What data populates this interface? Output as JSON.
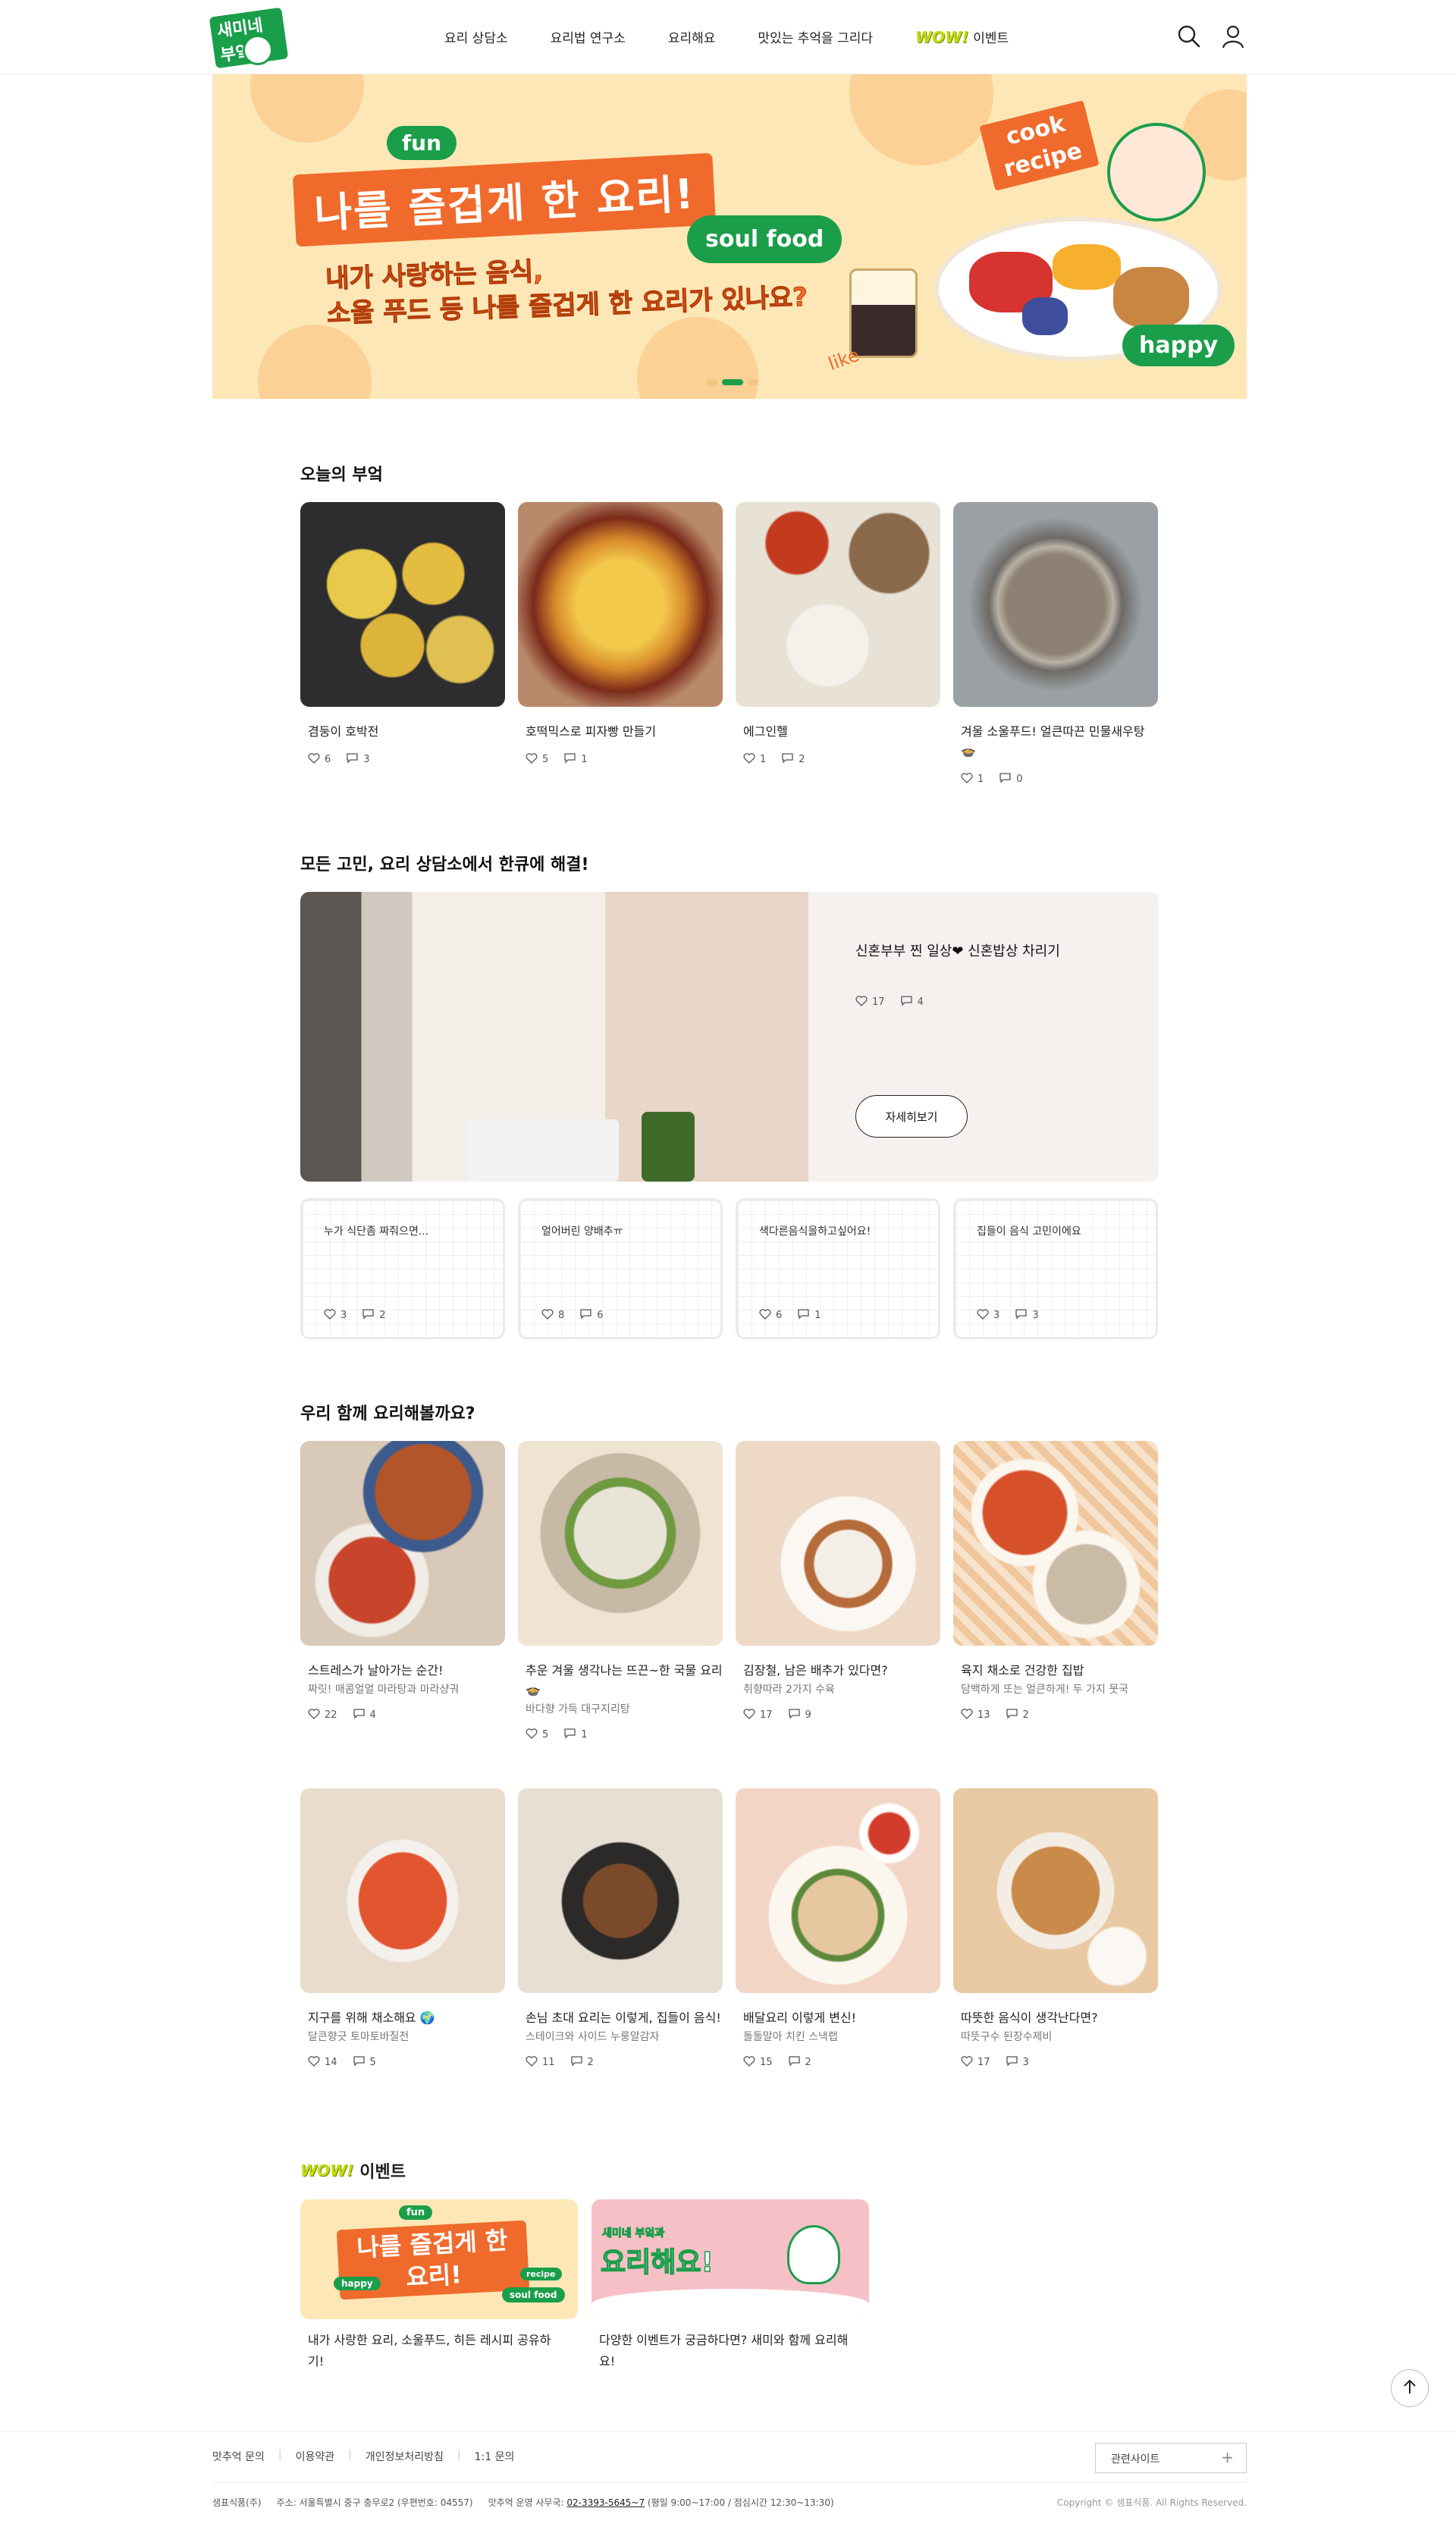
{
  "header": {
    "logo_text": "새미네부엌",
    "nav": [
      "요리 상담소",
      "요리법 연구소",
      "요리해요",
      "맛있는 추억을 그리다"
    ],
    "event_wow": "WOW!",
    "event_label": "이벤트",
    "icons": [
      "search-icon",
      "user-icon"
    ]
  },
  "banner": {
    "tag_fun": "fun",
    "title": "나를 즐겁게 한 요리!",
    "tag_soul": "soul food",
    "subtitle_1": "내가 사랑하는 음식,",
    "subtitle_2": "소울 푸드 등 나를 즐겁게 한 요리가 있나요?",
    "tag_cook": "cook",
    "tag_recipe": "recipe",
    "tag_happy": "happy",
    "tag_like": "like",
    "active_slide": 2,
    "slide_count": 3
  },
  "today": {
    "title": "오늘의 부엌",
    "cards": [
      {
        "title": "겸둥이 호박전",
        "likes": "6",
        "comments": "3"
      },
      {
        "title": "호떡믹스로 피자빵 만들기",
        "likes": "5",
        "comments": "1"
      },
      {
        "title": "에그인헬",
        "likes": "1",
        "comments": "2"
      },
      {
        "title": "겨울 소울푸드! 얼큰따끈 민물새우탕🍲",
        "likes": "1",
        "comments": "0"
      }
    ]
  },
  "consult": {
    "title": "모든 고민, 요리 상담소에서 한큐에 해결!",
    "feature": {
      "title": "신혼부부 찐 일상❤ 신혼밥상 차리기",
      "likes": "17",
      "comments": "4",
      "button": "자세히보기"
    },
    "questions": [
      {
        "text": "누가 식단좀 짜줘으면...",
        "likes": "3",
        "comments": "2"
      },
      {
        "text": "얼어버린 양배추ㅠ",
        "likes": "8",
        "comments": "6"
      },
      {
        "text": "색다른음식을하고싶어요!",
        "likes": "6",
        "comments": "1"
      },
      {
        "text": "집들이 음식 고민이에요",
        "likes": "3",
        "comments": "3"
      }
    ]
  },
  "cook": {
    "title": "우리 함께 요리해볼까요?",
    "cards": [
      {
        "title": "스트레스가 날아가는 순간!",
        "sub": "짜릿! 매콤얼얼 마라탕과 마라샹궈",
        "likes": "22",
        "comments": "4"
      },
      {
        "title": "추운 겨울 생각나는 뜨끈~한 국물 요리🍲",
        "sub": "바다향 가득 대구지리탕",
        "likes": "5",
        "comments": "1"
      },
      {
        "title": "김장철, 남은 배추가 있다면?",
        "sub": "취향따라 2가지 수육",
        "likes": "17",
        "comments": "9"
      },
      {
        "title": "육지 채소로 건강한 집밥",
        "sub": "담백하게 또는 얼큰하게! 두 가지 뭇국",
        "likes": "13",
        "comments": "2"
      },
      {
        "title": "지구를 위해 채소해요 🌍",
        "sub": "달큰향긋 토마토바질전",
        "likes": "14",
        "comments": "5"
      },
      {
        "title": "손님 초대 요리는 이렇게, 집들이 음식!",
        "sub": "스테이크와 사이드 누룽알감자",
        "likes": "11",
        "comments": "2"
      },
      {
        "title": "배달요리 이렇게 변신!",
        "sub": "돌돌말아 치킨 스낵랩",
        "likes": "15",
        "comments": "2"
      },
      {
        "title": "따뜻한 음식이 생각난다면?",
        "sub": "따뜻구수 된장수제비",
        "likes": "17",
        "comments": "3"
      }
    ]
  },
  "events": {
    "wow": "WOW!",
    "title": "이벤트",
    "cards": [
      {
        "desc": "내가 사랑한 요리, 소울푸드, 히든 레시피 공유하기!",
        "thumb_title": "나를 즐겁게 한 요리!",
        "thumb_fun": "fun",
        "thumb_happy": "happy",
        "thumb_recipe": "recipe",
        "thumb_soul": "soul food"
      },
      {
        "desc": "다양한 이벤트가 궁금하다면? 새미와 함께 요리해요!",
        "thumb_small": "새미네 부엌과",
        "thumb_title": "요리해요!"
      }
    ]
  },
  "footer": {
    "links": [
      "맛추억 문의",
      "이용약관",
      "개인정보처리방침",
      "1:1 문의"
    ],
    "related": "관련사이트",
    "company": "샘표식품(주)",
    "address": "주소: 서울특별시 중구 충무로2 (우편번호: 04557)",
    "office": "맛추억 운영 사무국:",
    "phone": "02-3393-5645~7",
    "hours": "(평일 9:00~17:00 / 점심시간 12:30~13:30)",
    "copyright": "Copyright © 샘표식품. All Rights Reserved."
  },
  "colors": {
    "brand_green": "#1a9e4a",
    "brand_orange": "#f06a2c",
    "banner_bg": "#fde7b6",
    "wow": "#c4dc14"
  }
}
